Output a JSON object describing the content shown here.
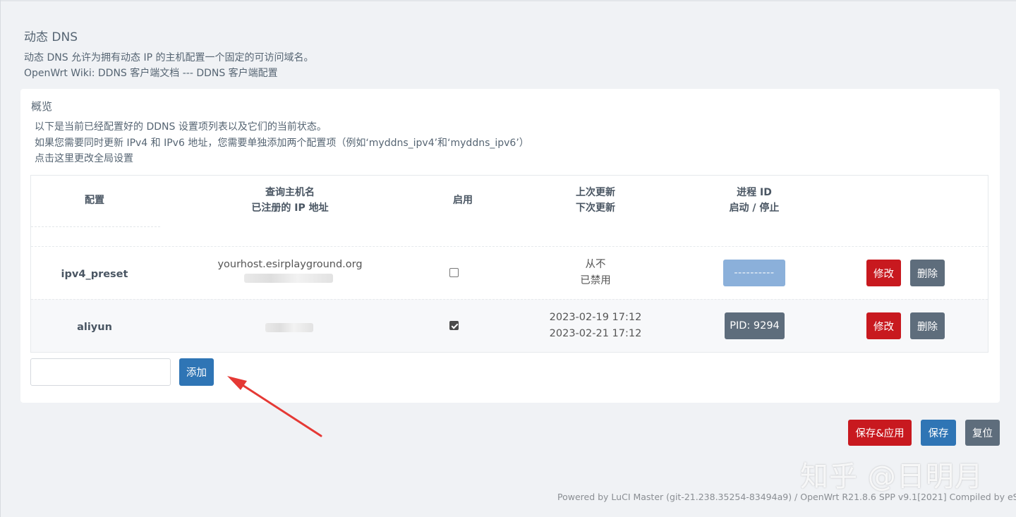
{
  "header": {
    "title": "动态 DNS",
    "desc_line1": "动态 DNS 允许为拥有动态 IP 的主机配置一个固定的可访问域名。",
    "desc_line2": "OpenWrt Wiki: DDNS 客户端文档 --- DDNS 客户端配置"
  },
  "overview": {
    "legend": "概览",
    "line1": "以下是当前已经配置好的 DDNS 设置项列表以及它们的当前状态。",
    "line2": "如果您需要同时更新 IPv4 和 IPv6 地址，您需要单独添加两个配置项（例如‘myddns_ipv4’和‘myddns_ipv6’）",
    "line3": "点击这里更改全局设置"
  },
  "table": {
    "headers": {
      "config": "配置",
      "host_line1": "查询主机名",
      "host_line2": "已注册的 IP 地址",
      "enabled": "启用",
      "update_line1": "上次更新",
      "update_line2": "下次更新",
      "pid_line1": "进程 ID",
      "pid_line2": "启动 / 停止"
    },
    "rows": [
      {
        "name": "ipv4_preset",
        "host": "yourhost.esirplayground.org",
        "enabled": false,
        "last_update": "从不",
        "next_update": "已禁用",
        "pid_label": "----------",
        "edit_label": "修改",
        "delete_label": "删除"
      },
      {
        "name": "aliyun",
        "host": "",
        "enabled": true,
        "last_update": "2023-02-19 17:12",
        "next_update": "2023-02-21 17:12",
        "pid_label": "PID: 9294",
        "edit_label": "修改",
        "delete_label": "删除"
      }
    ]
  },
  "add": {
    "input_value": "",
    "button_label": "添加"
  },
  "actions": {
    "save_apply": "保存&应用",
    "save": "保存",
    "reset": "复位"
  },
  "watermark": "知乎 @日明月",
  "footer": "Powered by LuCI Master (git-21.238.35254-83494a9) / OpenWrt R21.8.6 SPP v9.1[2021] Compiled by eS",
  "colors": {
    "danger": "#c8191f",
    "primary": "#2f75b5",
    "neutral": "#5e6d7c",
    "annotation_arrow": "#e53935"
  }
}
